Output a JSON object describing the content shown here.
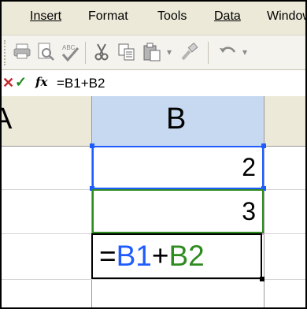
{
  "menu": {
    "items": [
      {
        "label": "Insert"
      },
      {
        "label": "Format"
      },
      {
        "label": "Tools"
      },
      {
        "label": "Data"
      },
      {
        "label": "Window"
      }
    ]
  },
  "toolbar": {
    "icons": [
      "print-icon",
      "print-preview-icon",
      "spelling-icon",
      "cut-icon",
      "copy-icon",
      "paste-icon",
      "format-painter-icon",
      "undo-icon"
    ]
  },
  "formula_bar": {
    "cancel_glyph": "✕",
    "enter_glyph": "✓",
    "fx_label": "fx",
    "formula": "=B1+B2"
  },
  "sheet": {
    "column_headers": {
      "a": "A",
      "b": "B"
    },
    "cells": {
      "b1": "2",
      "b2": "3"
    },
    "editing_cell": {
      "parts": [
        "=",
        "B1",
        "+",
        "B2"
      ],
      "colors": {
        "eq": "#000000",
        "ref1": "#1f5cff",
        "plus": "#000000",
        "ref2": "#2e8b1f"
      }
    }
  }
}
